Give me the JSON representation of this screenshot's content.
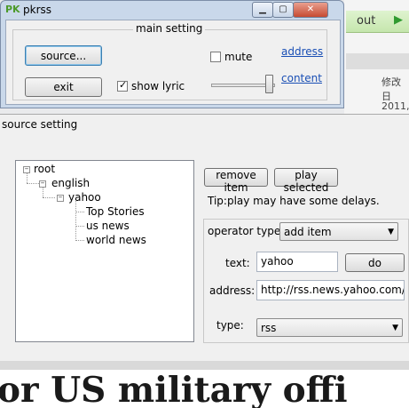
{
  "background_app": {
    "tab_label": "out",
    "text_1": "修改日",
    "text_2": "2011,"
  },
  "pkrss": {
    "logo": "PK",
    "title": "pkrss",
    "main_setting": {
      "legend": "main setting",
      "source_button": "source...",
      "exit_button": "exit",
      "mute_label": "mute",
      "mute_checked": false,
      "show_lyric_label": "show lyric",
      "show_lyric_checked": true,
      "address_link": "address",
      "content_link": "content",
      "slider_value": 0.9
    }
  },
  "source_setting": {
    "title": "source setting",
    "tree": {
      "root": "root",
      "english": "english",
      "yahoo": "yahoo",
      "leaves": [
        "Top Stories",
        "us news",
        "world news"
      ]
    },
    "remove_button": "remove item",
    "play_button": "play selected",
    "tip": "Tip:play may have some delays.",
    "operator_label": "operator type:",
    "operator_value": "add item",
    "text_label": "text:",
    "text_value": "yahoo",
    "do_button": "do",
    "address_label": "address:",
    "address_value": "http://rss.news.yahoo.com/rss/t",
    "type_label": "type:",
    "type_value": "rss"
  },
  "banner": {
    "text": "or US military offi"
  }
}
